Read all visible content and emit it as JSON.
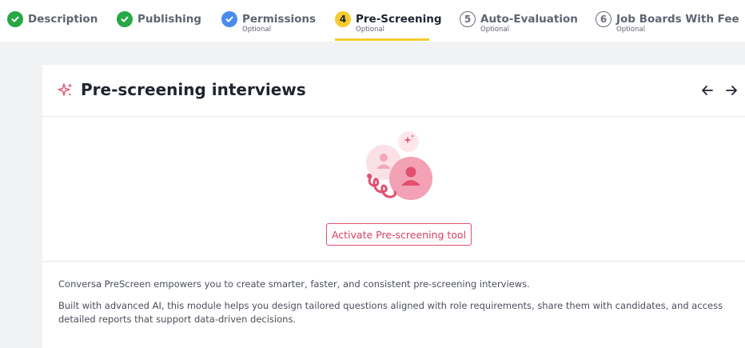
{
  "stepper": {
    "steps": [
      {
        "number": "",
        "label": "Description",
        "sub": "",
        "state": "done"
      },
      {
        "number": "",
        "label": "Publishing",
        "sub": "",
        "state": "done"
      },
      {
        "number": "",
        "label": "Permissions",
        "sub": "Optional",
        "state": "done-optional"
      },
      {
        "number": "4",
        "label": "Pre-Screening",
        "sub": "Optional",
        "state": "active"
      },
      {
        "number": "5",
        "label": "Auto-Evaluation",
        "sub": "Optional",
        "state": "todo"
      },
      {
        "number": "6",
        "label": "Job Boards With Fee",
        "sub": "Optional",
        "state": "todo"
      }
    ]
  },
  "card": {
    "title": "Pre-screening interviews",
    "icons": {
      "title_icon": "sparkle-icon",
      "prev": "arrow-left-icon",
      "next": "arrow-right-icon",
      "illustration": "pre-screening-illustration"
    },
    "activate_label": "Activate Pre-screening tool",
    "paragraph1": "Conversa PreScreen empowers you to create smarter, faster, and consistent pre-screening interviews.",
    "paragraph2": "Built with advanced AI, this module helps you design tailored questions aligned with role requirements, share them with candidates, and access detailed reports that support data-driven decisions."
  },
  "colors": {
    "done": "#27a745",
    "permissions": "#4a8bef",
    "active": "#f5cc30",
    "accent": "#e2506f",
    "background": "#f1f2f4"
  }
}
